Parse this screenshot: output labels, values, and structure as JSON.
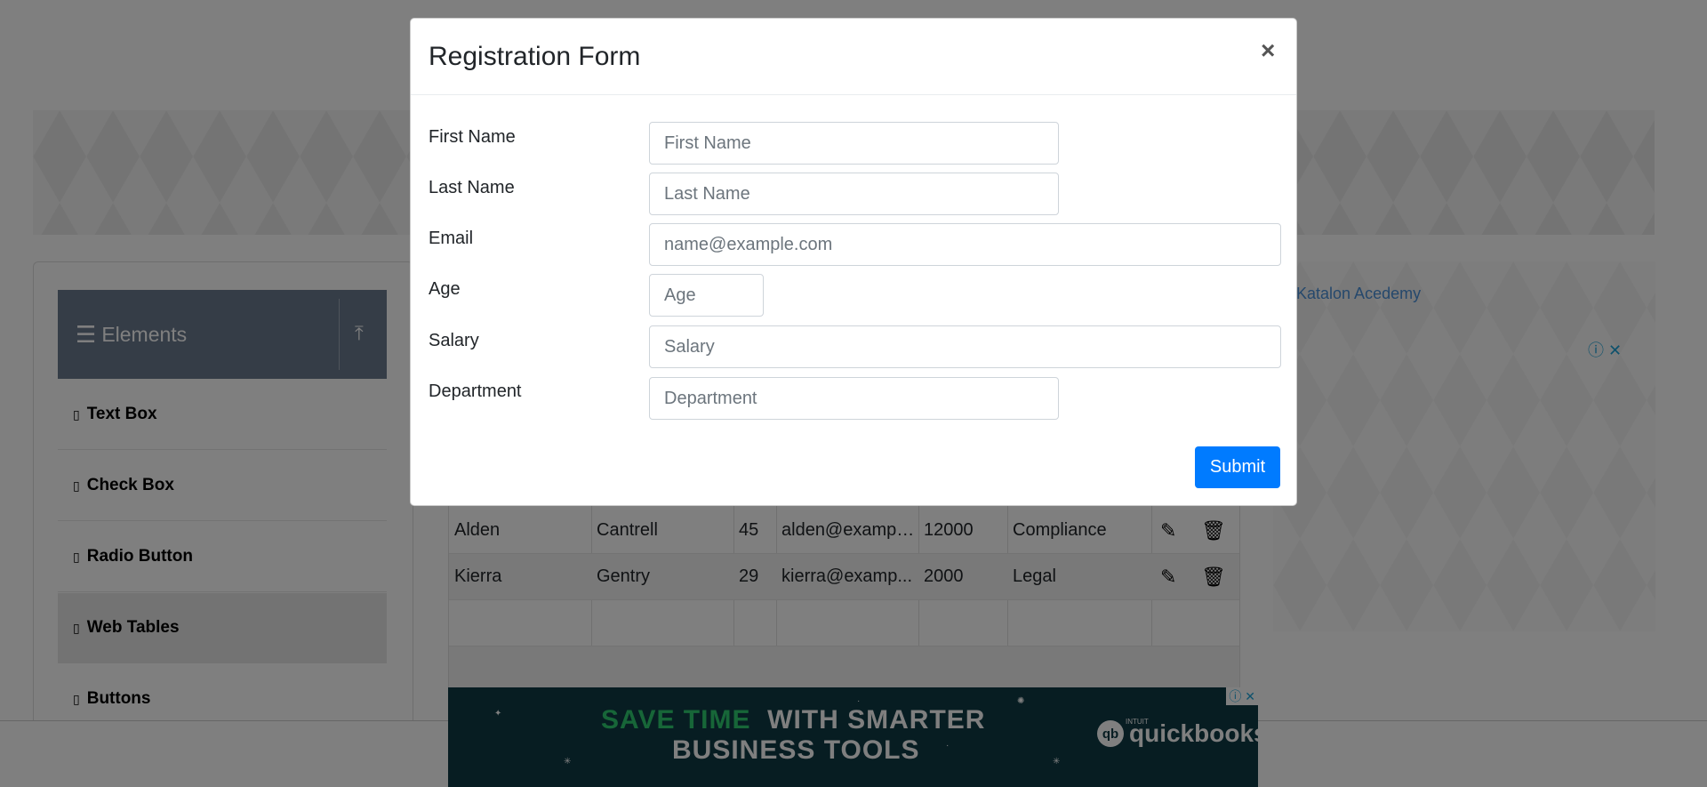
{
  "sidebar": {
    "group_icon": "hamburger-icon",
    "group_label": "Elements",
    "collapse_icon": "collapse-icon",
    "items": [
      {
        "label": "Text Box"
      },
      {
        "label": "Check Box"
      },
      {
        "label": "Radio Button"
      },
      {
        "label": "Web Tables",
        "active": true
      },
      {
        "label": "Buttons"
      }
    ]
  },
  "table": {
    "rows": [
      {
        "first": "Alden",
        "last": "Cantrell",
        "age": "45",
        "email": "alden@exampl...",
        "salary": "12000",
        "department": "Compliance"
      },
      {
        "first": "Kierra",
        "last": "Gentry",
        "age": "29",
        "email": "kierra@examp...",
        "salary": "2000",
        "department": "Legal"
      }
    ],
    "action_icons": [
      "edit-icon",
      "delete-icon"
    ]
  },
  "right_ad": {
    "link_text": "Katalon Acedemy"
  },
  "bottom_ad": {
    "highlight": "SAVE TIME",
    "line1_rest": "WITH SMARTER",
    "line2": "BUSINESS TOOLS",
    "brand_small": "INTUIT",
    "brand": "quickbooks",
    "colors": {
      "background": "#0e3a45",
      "highlight": "#2ecc71"
    }
  },
  "modal": {
    "title": "Registration Form",
    "close_glyph": "×",
    "fields": {
      "first_name": {
        "label": "First Name",
        "placeholder": "First Name",
        "value": ""
      },
      "last_name": {
        "label": "Last Name",
        "placeholder": "Last Name",
        "value": ""
      },
      "email": {
        "label": "Email",
        "placeholder": "name@example.com",
        "value": ""
      },
      "age": {
        "label": "Age",
        "placeholder": "Age",
        "value": ""
      },
      "salary": {
        "label": "Salary",
        "placeholder": "Salary",
        "value": ""
      },
      "department": {
        "label": "Department",
        "placeholder": "Department",
        "value": ""
      }
    },
    "submit_label": "Submit",
    "colors": {
      "primary": "#007bff"
    }
  }
}
